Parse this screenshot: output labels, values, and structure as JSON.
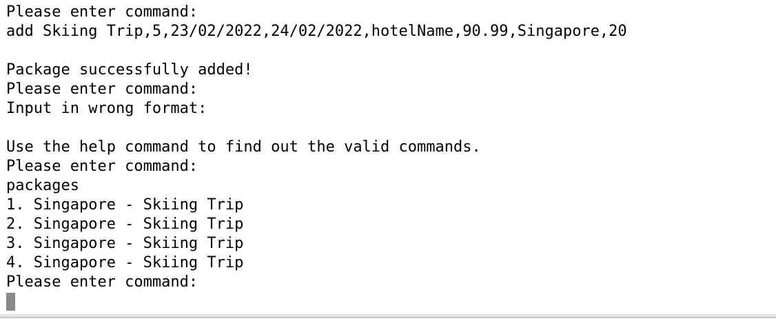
{
  "terminal": {
    "lines": [
      "Please enter command:",
      "add Skiing Trip,5,23/02/2022,24/02/2022,hotelName,90.99,Singapore,20",
      "",
      "Package successfully added!",
      "Please enter command:",
      "Input in wrong format:",
      "",
      "Use the help command to find out the valid commands.",
      "Please enter command:",
      "packages",
      "1. Singapore - Skiing Trip",
      "2. Singapore - Skiing Trip",
      "3. Singapore - Skiing Trip",
      "4. Singapore - Skiing Trip",
      "Please enter command:"
    ],
    "input_value": ""
  }
}
